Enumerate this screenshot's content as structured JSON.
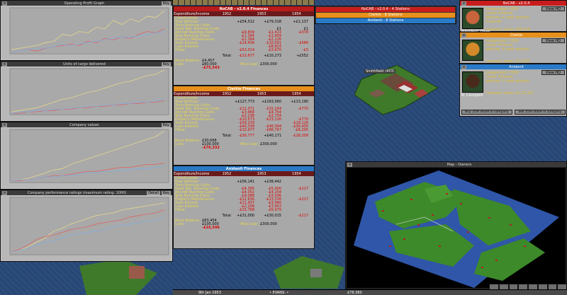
{
  "graphs": [
    {
      "title": "Operating Profit Graph",
      "key": "Key"
    },
    {
      "title": "Units of cargo delivered",
      "key": "Key"
    },
    {
      "title": "Company values",
      "key": "Key"
    },
    {
      "title": "Company performance ratings (maximum rating: 1000)",
      "key": "Key",
      "detail": "Detail"
    }
  ],
  "finances": [
    {
      "title": "NoCAB - v2.0.4 Finances",
      "header_color": "#b81c1c",
      "columns": [
        "Expenditure/Income",
        "1952",
        "1953",
        "1954"
      ],
      "rows": [
        {
          "label": "Construction",
          "v": [
            "",
            "",
            ""
          ]
        },
        {
          "label": "New Vehicles",
          "v": [
            "+£54,512",
            "+£79,318",
            "+£1,137"
          ]
        },
        {
          "label": "Train Running Costs",
          "v": [
            "",
            "",
            ""
          ]
        },
        {
          "label": "Road Veh. Running Costs",
          "v": [
            "",
            "£1",
            "£1"
          ]
        },
        {
          "label": "Aircraft Running Costs",
          "v": [
            "-£9,839",
            "-£1,413",
            "-£378"
          ]
        },
        {
          "label": "Ship Running Costs",
          "v": [
            "-£1,364",
            "-£1,659",
            ""
          ]
        },
        {
          "label": "Property Maintenance",
          "v": [
            "-£1,364",
            "-£2,126",
            ""
          ]
        },
        {
          "label": "Train Income",
          "v": [
            "-£14,436",
            "-£10,001",
            "-£586"
          ]
        },
        {
          "label": "Loan Interest",
          "v": [
            "",
            "-£8,823",
            ""
          ]
        },
        {
          "label": "Other",
          "v": [
            "-£53,314",
            "-£3,670",
            "-£5"
          ]
        }
      ],
      "total": [
        "-£13,677",
        "+£10,273",
        "+£552"
      ],
      "bank_balance": "£4,457",
      "loan": "£80,000",
      "max_loan_label": "Max Loan:",
      "max_loan": "£300,000",
      "net": "-£75,543"
    },
    {
      "title": "Clarkie Finances",
      "header_color": "#e8901c",
      "columns": [
        "Expenditure/Income",
        "1952",
        "1953",
        "1954"
      ],
      "rows": [
        {
          "label": "Construction",
          "v": [
            "",
            "",
            ""
          ]
        },
        {
          "label": "New Vehicles",
          "v": [
            "+£127,773",
            "+£163,060",
            "+£13,190"
          ]
        },
        {
          "label": "Train Running Costs",
          "v": [
            "",
            "",
            ""
          ]
        },
        {
          "label": "Road Veh. Running Costs",
          "v": [
            "-£11,071",
            "-£15,244",
            "-£770"
          ]
        },
        {
          "label": "Aircraft Running Costs",
          "v": [
            "-£3,968",
            "-£4,754",
            ""
          ]
        },
        {
          "label": "Ship Running Costs",
          "v": [
            "-£2,238",
            "-£2,754",
            ""
          ]
        },
        {
          "label": "Property Maintenance",
          "v": [
            "-£10,573",
            "-£23,130",
            "-£770"
          ]
        },
        {
          "label": "Train Income",
          "v": [
            "-£59,239",
            "",
            "-£19,126"
          ]
        },
        {
          "label": "Loan Interest",
          "v": [
            "-£40,338",
            "-£46,394",
            "-£30,405"
          ]
        },
        {
          "label": "Other",
          "v": [
            "-£10,977",
            "-£66,747",
            "-£8,205"
          ]
        }
      ],
      "total": [
        "-£30,777",
        "+£40,171",
        "-£28,308"
      ],
      "bank_balance": "£30,668",
      "loan": "£100,000",
      "max_loan_label": "Max Loan:",
      "max_loan": "£300,000",
      "net": "-£76,332"
    },
    {
      "title": "Anidanit Finances",
      "header_color": "#2a7ac8",
      "columns": [
        "Expenditure/Income",
        "1952",
        "1953",
        "1954"
      ],
      "rows": [
        {
          "label": "Construction",
          "v": [
            "",
            "",
            ""
          ]
        },
        {
          "label": "New Vehicles",
          "v": [
            "+£56,141",
            "+£38,442",
            ""
          ]
        },
        {
          "label": "Train Running Costs",
          "v": [
            "",
            "",
            ""
          ]
        },
        {
          "label": "Road Veh. Running Costs",
          "v": [
            "-£4,395",
            "-£5,000",
            "-£217"
          ]
        },
        {
          "label": "Aircraft Running Costs",
          "v": [
            "-£4,052",
            "-£4,254",
            ""
          ]
        },
        {
          "label": "Ship Running Costs",
          "v": [
            "-£9,088",
            "-£3,006",
            ""
          ]
        },
        {
          "label": "Property Maintenance",
          "v": [
            "-£12,636",
            "-£13,336",
            "-£217"
          ]
        },
        {
          "label": "Train Income",
          "v": [
            "-£11,437",
            "-£3,940",
            ""
          ]
        },
        {
          "label": "Loan Interest",
          "v": [
            "-£2,208",
            "-£3,953",
            ""
          ]
        },
        {
          "label": "Other",
          "v": [
            "-£15,768",
            "-£6,979",
            ""
          ]
        }
      ],
      "total": [
        "+£31,000",
        "+£30,015",
        "-£217"
      ],
      "bank_balance": "£83,454",
      "loan": "£100,000",
      "max_loan_label": "Max Loan:",
      "max_loan": "£300,000",
      "net": "-£16,546"
    }
  ],
  "league": {
    "rows": [
      {
        "text": "NoCAB - v2.0.4 - 4 Stations",
        "color": "#c81c1c"
      },
      {
        "text": "Clarkie - 8 Stations",
        "color": "#e8901c"
      },
      {
        "text": "Anidanit - 8 Stations",
        "color": "#2a7ac8"
      }
    ]
  },
  "companies": [
    {
      "title": "NoCAB - v2.0.4",
      "header_color": "#c81c1c",
      "president": "President: Oliver",
      "info": [
        "Inaugurated: 1950",
        "Colour Scheme:",
        "Vehicles: 4 road vehicles",
        "4 aircraft"
      ],
      "value": "Company value: £46,219",
      "view_hq": "View HQ"
    },
    {
      "title": "Clarkie",
      "header_color": "#e8901c",
      "president": "",
      "info": [
        "Inaugurated: 1950",
        "Colour Scheme:",
        "Vehicles: 8 road vehicles"
      ],
      "value": "Company value: £71,207",
      "view_hq": "View HQ"
    },
    {
      "title": "Anidanit",
      "header_color": "#2a7ac8",
      "president": "N. Campbell",
      "info": [
        "Inaugurated: 1950",
        "Colour Scheme:",
        "Vehicles: 2 road vehicles"
      ],
      "value": "Company value: £1,72,307",
      "view_hq": "View HQ",
      "buttons": [
        "Buy 25% share in company",
        "Sell 25% share in company"
      ]
    }
  ],
  "town_label": "Smithfield (453)",
  "map": {
    "title": "Map - Owners"
  },
  "status": {
    "news": "9th Jan 1953",
    "center": "• EVANS: •",
    "money": "£78,360"
  }
}
